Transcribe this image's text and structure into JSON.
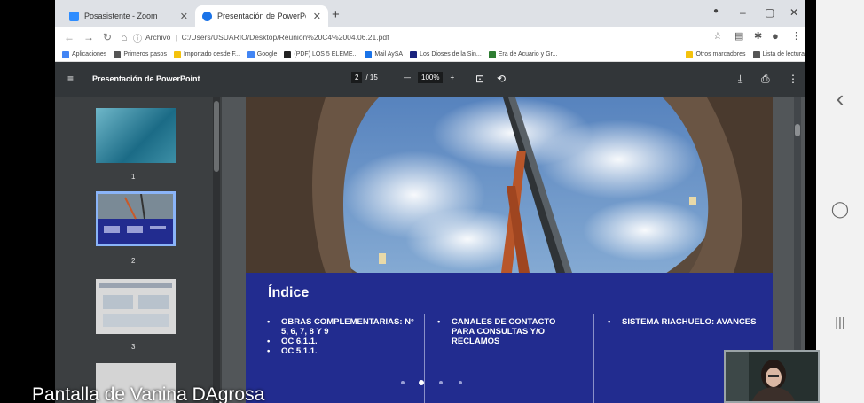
{
  "browser": {
    "tabs": [
      {
        "title": "Posasistente - Zoom",
        "favicon_color": "#2d8cff"
      },
      {
        "title": "Presentación de PowerPoint",
        "favicon_color": "#1a73e8"
      }
    ],
    "new_tab": "+",
    "window_controls": {
      "minimize": "–",
      "maximize": "▢",
      "close": "✕"
    },
    "address": {
      "security_label": "Archivo",
      "url": "C:/Users/USUARIO/Desktop/Reunión%20C4%2004.06.21.pdf"
    },
    "bookmarks": [
      {
        "label": "Aplicaciones",
        "color": "#4285f4"
      },
      {
        "label": "Primeros pasos",
        "color": "#555555"
      },
      {
        "label": "Importado desde F...",
        "color": "#f4c20d"
      },
      {
        "label": "Google",
        "color": "#4285f4"
      },
      {
        "label": "(PDF) LOS 5 ELEME...",
        "color": "#222222"
      },
      {
        "label": "Mail AySA",
        "color": "#1a73e8"
      },
      {
        "label": "Los Dioses de la Sin...",
        "color": "#1a237e"
      },
      {
        "label": "Era de Acuario y Gr...",
        "color": "#2e7d32"
      }
    ],
    "bookmarks_right": [
      {
        "label": "Otros marcadores",
        "color": "#f4c20d"
      },
      {
        "label": "Lista de lectura",
        "color": "#555555"
      }
    ]
  },
  "pdf_viewer": {
    "title": "Presentación de PowerPoint",
    "page_current": "2",
    "page_total": "/ 15",
    "zoom_out": "—",
    "zoom": "100%",
    "zoom_in": "+",
    "thumbnails": [
      "1",
      "2",
      "3"
    ]
  },
  "slide": {
    "heading": "Índice",
    "columns": [
      [
        "OBRAS COMPLEMENTARIAS: N° 5, 6, 7, 8 Y 9",
        "OC 6.1.1.",
        "OC 5.1.1."
      ],
      [
        "CANALES DE CONTACTO PARA CONSULTAS Y/O RECLAMOS"
      ],
      [
        "SISTEMA RIACHUELO: AVANCES"
      ]
    ],
    "accent_color": "#222c8f"
  },
  "zoom_overlay": {
    "presenter_label": "Pantalla de Vanina DAgrosa"
  },
  "phone_nav": {
    "back": "‹",
    "home": "◯",
    "recents": "|||"
  }
}
